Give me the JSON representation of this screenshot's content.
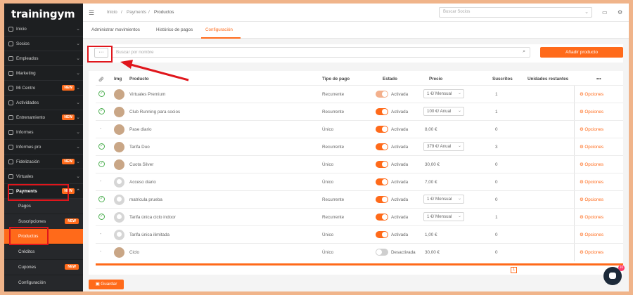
{
  "app": {
    "logo": "trainingym"
  },
  "sidebar": {
    "items": [
      {
        "label": "Inicio",
        "new": false
      },
      {
        "label": "Socios",
        "new": false
      },
      {
        "label": "Empleados",
        "new": false
      },
      {
        "label": "Marketing",
        "new": false
      },
      {
        "label": "Mi Centro",
        "new": true
      },
      {
        "label": "Actividades",
        "new": false
      },
      {
        "label": "Entrenamiento",
        "new": true
      },
      {
        "label": "Informes",
        "new": false
      },
      {
        "label": "Informes pro",
        "new": false
      },
      {
        "label": "Fidelización",
        "new": true
      },
      {
        "label": "Virtuales",
        "new": false
      },
      {
        "label": "Payments",
        "new": true
      }
    ],
    "subitems": [
      {
        "label": "Pagos",
        "new": false
      },
      {
        "label": "Suscripciones",
        "new": true
      },
      {
        "label": "Productos",
        "new": false
      },
      {
        "label": "Créditos",
        "new": false
      },
      {
        "label": "Cupones",
        "new": true
      },
      {
        "label": "Configuración",
        "new": false
      }
    ],
    "new_label": "NEW"
  },
  "breadcrumb": {
    "home": "Inicio",
    "sep": "/",
    "section": "Payments",
    "page": "Productos"
  },
  "topbar": {
    "search_placeholder": "Buscar Socios"
  },
  "tabs": [
    "Administrar movimientos",
    "Histórico de pagos",
    "Configuración"
  ],
  "toolbar": {
    "dots": "···",
    "search_placeholder": "Buscar por nombre",
    "add_label": "Añadir producto"
  },
  "table": {
    "headers": {
      "img": "Img",
      "producto": "Producto",
      "tipo": "Tipo de pago",
      "estado": "Estado",
      "precio": "Precio",
      "suscritos": "Suscritos",
      "unidades": "Unidades restantes",
      "more": "•••"
    },
    "rows": [
      {
        "producto": "Virtuales Premium",
        "tipo": "Recurrente",
        "estado": "Activada",
        "precio": "1 €/ Mensual",
        "precio_select": true,
        "suscritos": "1",
        "opciones": "Opciones"
      },
      {
        "producto": "Club Running para socios",
        "tipo": "Recurrente",
        "estado": "Activada",
        "precio": "100 €/ Anual",
        "precio_select": true,
        "suscritos": "1",
        "opciones": "Opciones"
      },
      {
        "producto": "Pase diario",
        "tipo": "Único",
        "estado": "Activada",
        "precio": "8,00 €",
        "precio_select": false,
        "suscritos": "0",
        "opciones": "Opciones"
      },
      {
        "producto": "Tarifa Duo",
        "tipo": "Recurrente",
        "estado": "Activada",
        "precio": "379 €/ Anual",
        "precio_select": true,
        "suscritos": "3",
        "opciones": "Opciones"
      },
      {
        "producto": "Cuota Silver",
        "tipo": "Único",
        "estado": "Activada",
        "precio": "30,00 €",
        "precio_select": false,
        "suscritos": "0",
        "opciones": "Opciones"
      },
      {
        "producto": "Acceso diario",
        "tipo": "Único",
        "estado": "Activada",
        "precio": "7,00 €",
        "precio_select": false,
        "suscritos": "0",
        "opciones": "Opciones"
      },
      {
        "producto": "matricula prueba",
        "tipo": "Recurrente",
        "estado": "Activada",
        "precio": "1 €/ Mensual",
        "precio_select": true,
        "suscritos": "0",
        "opciones": "Opciones"
      },
      {
        "producto": "Tarifa única ciclo indoor",
        "tipo": "Recurrente",
        "estado": "Activada",
        "precio": "1 €/ Mensual",
        "precio_select": true,
        "suscritos": "1",
        "opciones": "Opciones"
      },
      {
        "producto": "Tarifa única ilimitada",
        "tipo": "Único",
        "estado": "Activada",
        "precio": "1,00 €",
        "precio_select": false,
        "suscritos": "0",
        "opciones": "Opciones"
      },
      {
        "producto": "Ciclo",
        "tipo": "Único",
        "estado": "Desactivada",
        "precio": "30,00 €",
        "precio_select": false,
        "suscritos": "0",
        "opciones": "Opciones"
      }
    ]
  },
  "pagination": {
    "current": "1"
  },
  "footer": {
    "save_label": "Guardar"
  },
  "chat": {
    "badge": "10"
  },
  "colors": {
    "accent": "#ff6a1a",
    "sidebar": "#1d1f21",
    "highlight": "#e0161c"
  }
}
